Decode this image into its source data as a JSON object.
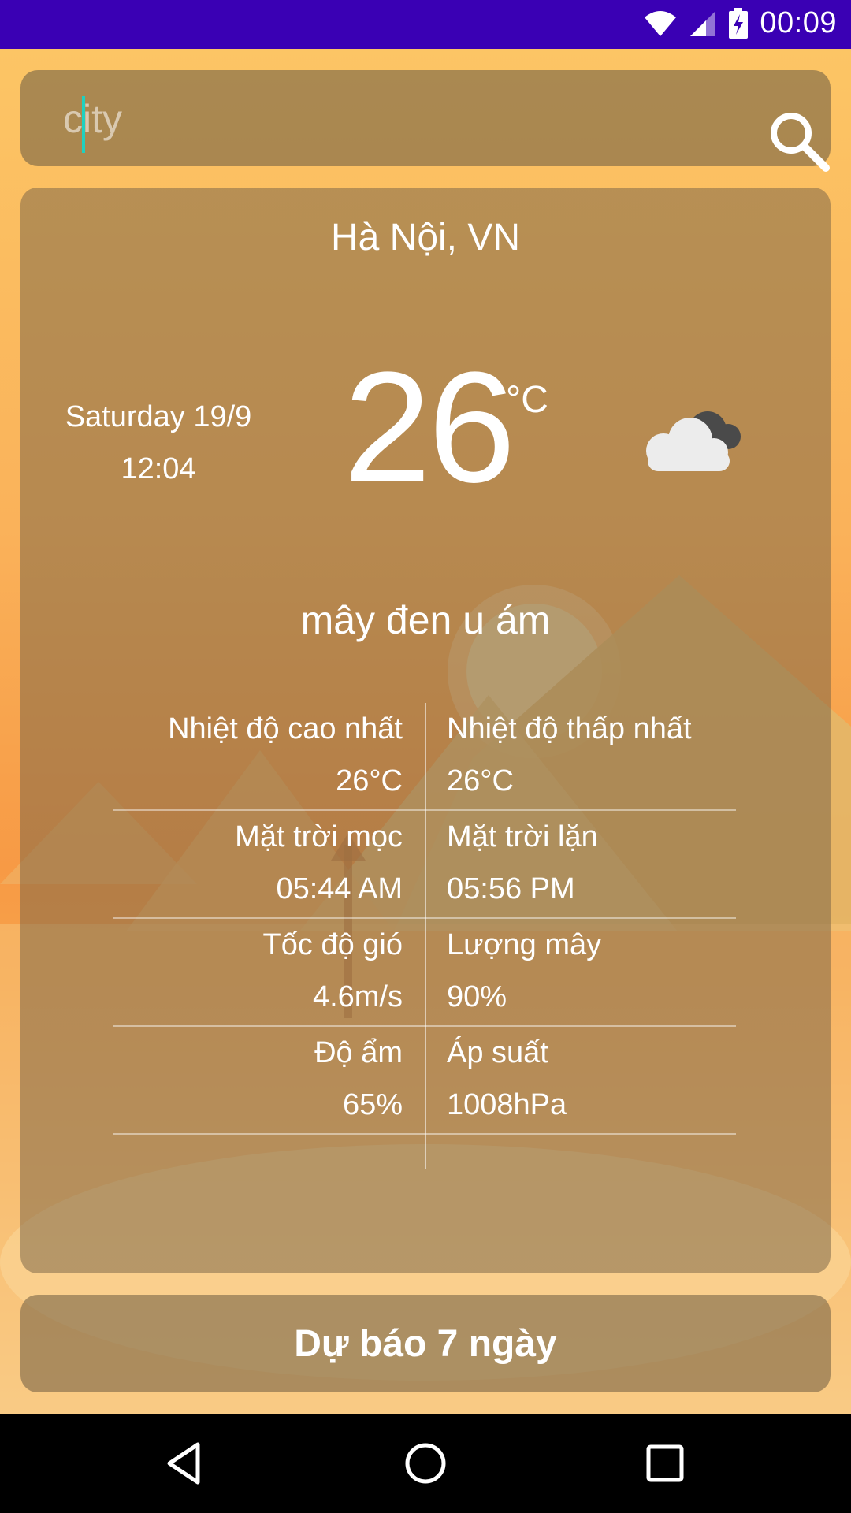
{
  "status_bar": {
    "time": "00:09"
  },
  "search": {
    "placeholder": "city"
  },
  "weather": {
    "city": "Hà Nội, VN",
    "date": "Saturday 19/9",
    "time": "12:04",
    "temperature": "26",
    "unit": "°C",
    "description": "mây đen u ám",
    "icon": "dark-cloud-icon"
  },
  "details": {
    "rows": [
      {
        "left_label": "Nhiệt độ cao nhất",
        "left_value": "26°C",
        "right_label": "Nhiệt độ thấp nhất",
        "right_value": "26°C"
      },
      {
        "left_label": "Mặt trời mọc",
        "left_value": "05:44 AM",
        "right_label": "Mặt trời lặn",
        "right_value": "05:56 PM"
      },
      {
        "left_label": "Tốc độ gió",
        "left_value": "4.6m/s",
        "right_label": "Lượng mây",
        "right_value": "90%"
      },
      {
        "left_label": "Độ ẩm",
        "left_value": "65%",
        "right_label": "Áp suất",
        "right_value": "1008hPa"
      }
    ]
  },
  "forecast_button": {
    "label": "Dự báo 7 ngày"
  },
  "colors": {
    "status_bar": "#3a00b4",
    "accent_cursor": "#1fd1c0"
  }
}
